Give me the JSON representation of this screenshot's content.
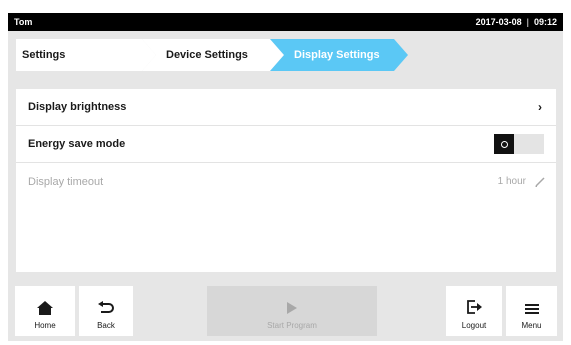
{
  "status": {
    "user": "Tom",
    "date": "2017-03-08",
    "separator": "|",
    "time": "09:12"
  },
  "breadcrumb": {
    "items": [
      {
        "label": "Settings"
      },
      {
        "label": "Device Settings"
      },
      {
        "label": "Display Settings",
        "active": true
      }
    ]
  },
  "settings": {
    "brightness": {
      "label": "Display brightness"
    },
    "energy_save": {
      "label": "Energy save mode",
      "toggle_on": false
    },
    "timeout": {
      "label": "Display timeout",
      "value": "1 hour"
    }
  },
  "bottom_bar": {
    "home": {
      "label": "Home",
      "icon": "home-icon"
    },
    "back": {
      "label": "Back",
      "icon": "back-arrow-icon"
    },
    "start_program": {
      "label": "Start Program",
      "icon": "play-icon",
      "enabled": false
    },
    "logout": {
      "label": "Logout",
      "icon": "logout-icon"
    },
    "menu": {
      "label": "Menu",
      "icon": "hamburger-menu-icon"
    }
  },
  "colors": {
    "accent": "#5bc8f5",
    "status_bar": "#000000",
    "panel_bg": "#e6e6e6",
    "disabled_text": "#a8a8a8"
  }
}
